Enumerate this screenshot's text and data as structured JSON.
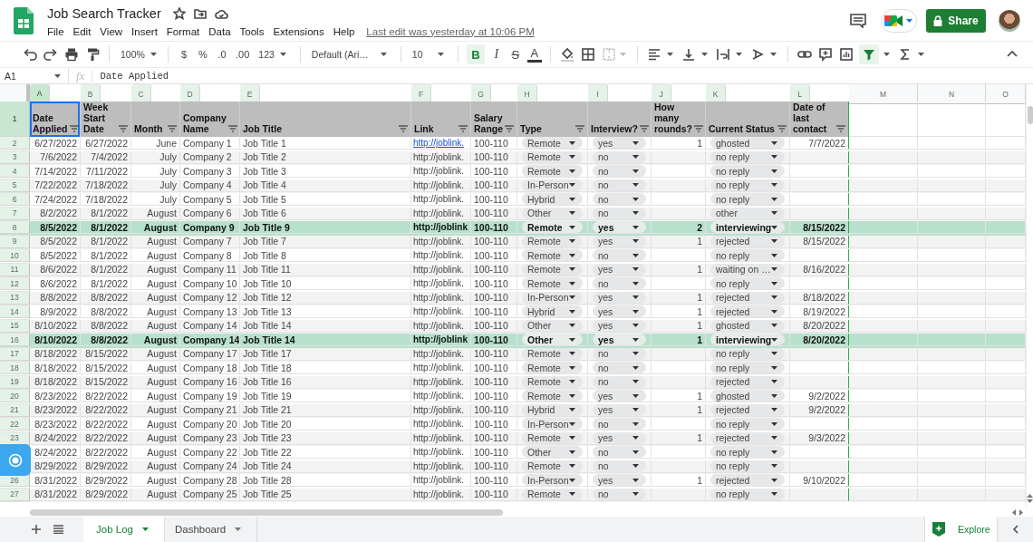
{
  "app": {
    "title": "Job Search Tracker",
    "menu": [
      "File",
      "Edit",
      "View",
      "Insert",
      "Format",
      "Data",
      "Tools",
      "Extensions",
      "Help"
    ],
    "last_edit": "Last edit was yesterday at 10:06 PM",
    "share": "Share"
  },
  "toolbar": {
    "zoom": "100%",
    "currency": "$",
    "percent": "%",
    "decimal_decrease": ".0",
    "decimal_increase": ".00",
    "number_format": "123",
    "font": "Default (Ari…",
    "font_size": "10",
    "bold": {
      "label": "B",
      "on": true
    },
    "italic": "I",
    "strikethrough": "S",
    "text_color": "A",
    "filter_on": true
  },
  "formula_bar": {
    "cell": "A1",
    "fx": "fx",
    "value": "Date Applied"
  },
  "columns": [
    {
      "letter": "A",
      "selected": true,
      "filtered": true
    },
    {
      "letter": "B",
      "selected": false,
      "filtered": true
    },
    {
      "letter": "C",
      "selected": false,
      "filtered": true
    },
    {
      "letter": "D",
      "selected": false,
      "filtered": true
    },
    {
      "letter": "E",
      "selected": false,
      "filtered": true
    },
    {
      "letter": "F",
      "selected": false,
      "filtered": true
    },
    {
      "letter": "G",
      "selected": false,
      "filtered": true
    },
    {
      "letter": "H",
      "selected": false,
      "filtered": true
    },
    {
      "letter": "I",
      "selected": false,
      "filtered": true
    },
    {
      "letter": "J",
      "selected": false,
      "filtered": true
    },
    {
      "letter": "K",
      "selected": false,
      "filtered": true
    },
    {
      "letter": "L",
      "selected": false,
      "filtered": true
    },
    {
      "letter": "M",
      "selected": false,
      "filtered": false
    },
    {
      "letter": "N",
      "selected": false,
      "filtered": false
    },
    {
      "letter": "O",
      "selected": false,
      "filtered": false
    }
  ],
  "header_row": {
    "num": "1",
    "cells": [
      {
        "text": "Date Applied",
        "kind": "date"
      },
      {
        "text": "Week Start Date",
        "kind": "date"
      },
      {
        "text": "Month",
        "kind": "month"
      },
      {
        "text": "Company Name",
        "kind": "text"
      },
      {
        "text": "Job Title",
        "kind": "text"
      },
      {
        "text": "Link",
        "kind": "link"
      },
      {
        "text": "Salary Range",
        "kind": "text"
      },
      {
        "text": "Type",
        "kind": "choice"
      },
      {
        "text": "Interview?",
        "kind": "choice"
      },
      {
        "text": "How many rounds?",
        "kind": "count"
      },
      {
        "text": "Current Status",
        "kind": "choice"
      },
      {
        "text": "Date of last contact",
        "kind": "date"
      }
    ]
  },
  "rows": [
    {
      "num": "2",
      "highlighted": false,
      "link_underlined": true,
      "cells": [
        "6/27/2022",
        "6/27/2022",
        "June",
        "Company 1",
        "Job Title 1",
        "http://joblink.",
        "100-110",
        "Remote",
        "yes",
        "1",
        "ghosted",
        "7/7/2022"
      ]
    },
    {
      "num": "3",
      "highlighted": false,
      "link_underlined": false,
      "cells": [
        "7/6/2022",
        "7/4/2022",
        "July",
        "Company 2",
        "Job Title 2",
        "http://joblink.",
        "100-110",
        "Remote",
        "no",
        null,
        "no reply",
        null
      ]
    },
    {
      "num": "4",
      "highlighted": false,
      "link_underlined": false,
      "cells": [
        "7/14/2022",
        "7/11/2022",
        "July",
        "Company 3",
        "Job Title 3",
        "http://joblink.",
        "100-110",
        "Remote",
        "no",
        null,
        "no reply",
        null
      ]
    },
    {
      "num": "5",
      "highlighted": false,
      "link_underlined": false,
      "cells": [
        "7/22/2022",
        "7/18/2022",
        "July",
        "Company 4",
        "Job Title 4",
        "http://joblink.",
        "100-110",
        "In-Person",
        "no",
        null,
        "no reply",
        null
      ]
    },
    {
      "num": "6",
      "highlighted": false,
      "link_underlined": false,
      "cells": [
        "7/24/2022",
        "7/18/2022",
        "July",
        "Company 5",
        "Job Title 5",
        "http://joblink.",
        "100-110",
        "Hybrid",
        "no",
        null,
        "no reply",
        null
      ]
    },
    {
      "num": "7",
      "highlighted": false,
      "link_underlined": false,
      "cells": [
        "8/2/2022",
        "8/1/2022",
        "August",
        "Company 6",
        "Job Title 6",
        "http://joblink.",
        "100-110",
        "Other",
        "no",
        null,
        "other",
        null
      ]
    },
    {
      "num": "8",
      "highlighted": true,
      "link_underlined": false,
      "cells": [
        "8/5/2022",
        "8/1/2022",
        "August",
        "Company 9",
        "Job Title 9",
        "http://joblink",
        "100-110",
        "Remote",
        "yes",
        "2",
        "interviewing",
        "8/15/2022"
      ]
    },
    {
      "num": "9",
      "highlighted": false,
      "link_underlined": false,
      "cells": [
        "8/5/2022",
        "8/1/2022",
        "August",
        "Company 7",
        "Job Title 7",
        "http://joblink.",
        "100-110",
        "Remote",
        "yes",
        "1",
        "rejected",
        "8/15/2022"
      ]
    },
    {
      "num": "10",
      "highlighted": false,
      "link_underlined": false,
      "cells": [
        "8/5/2022",
        "8/1/2022",
        "August",
        "Company 8",
        "Job Title 8",
        "http://joblink.",
        "100-110",
        "Remote",
        "no",
        null,
        "no reply",
        null
      ]
    },
    {
      "num": "11",
      "highlighted": false,
      "link_underlined": false,
      "cells": [
        "8/6/2022",
        "8/1/2022",
        "August",
        "Company 11",
        "Job Title 11",
        "http://joblink.",
        "100-110",
        "Remote",
        "yes",
        "1",
        "waiting on …",
        "8/16/2022"
      ]
    },
    {
      "num": "12",
      "highlighted": false,
      "link_underlined": false,
      "cells": [
        "8/6/2022",
        "8/1/2022",
        "August",
        "Company 10",
        "Job Title 10",
        "http://joblink.",
        "100-110",
        "Remote",
        "no",
        null,
        "no reply",
        null
      ]
    },
    {
      "num": "13",
      "highlighted": false,
      "link_underlined": false,
      "cells": [
        "8/8/2022",
        "8/8/2022",
        "August",
        "Company 12",
        "Job Title 12",
        "http://joblink.",
        "100-110",
        "In-Person",
        "yes",
        "1",
        "rejected",
        "8/18/2022"
      ]
    },
    {
      "num": "14",
      "highlighted": false,
      "link_underlined": false,
      "cells": [
        "8/9/2022",
        "8/8/2022",
        "August",
        "Company 13",
        "Job Title 13",
        "http://joblink.",
        "100-110",
        "Hybrid",
        "yes",
        "1",
        "rejected",
        "8/19/2022"
      ]
    },
    {
      "num": "15",
      "highlighted": false,
      "link_underlined": false,
      "cells": [
        "8/10/2022",
        "8/8/2022",
        "August",
        "Company 14",
        "Job Title 14",
        "http://joblink.",
        "100-110",
        "Other",
        "yes",
        "1",
        "ghosted",
        "8/20/2022"
      ]
    },
    {
      "num": "16",
      "highlighted": true,
      "link_underlined": false,
      "cells": [
        "8/10/2022",
        "8/8/2022",
        "August",
        "Company 14",
        "Job Title 14",
        "http://joblink",
        "100-110",
        "Other",
        "yes",
        "1",
        "interviewing",
        "8/20/2022"
      ]
    },
    {
      "num": "17",
      "highlighted": false,
      "link_underlined": false,
      "cells": [
        "8/18/2022",
        "8/15/2022",
        "August",
        "Company 17",
        "Job Title 17",
        "http://joblink.",
        "100-110",
        "Remote",
        "no",
        null,
        "no reply",
        null
      ]
    },
    {
      "num": "18",
      "highlighted": false,
      "link_underlined": false,
      "cells": [
        "8/18/2022",
        "8/15/2022",
        "August",
        "Company 18",
        "Job Title 18",
        "http://joblink.",
        "100-110",
        "Remote",
        "no",
        null,
        "no reply",
        null
      ]
    },
    {
      "num": "19",
      "highlighted": false,
      "link_underlined": false,
      "cells": [
        "8/18/2022",
        "8/15/2022",
        "August",
        "Company 16",
        "Job Title 16",
        "http://joblink.",
        "100-110",
        "Remote",
        "no",
        null,
        "rejected",
        null
      ]
    },
    {
      "num": "20",
      "highlighted": false,
      "link_underlined": false,
      "cells": [
        "8/23/2022",
        "8/22/2022",
        "August",
        "Company 19",
        "Job Title 19",
        "http://joblink.",
        "100-110",
        "Remote",
        "yes",
        "1",
        "ghosted",
        "9/2/2022"
      ]
    },
    {
      "num": "21",
      "highlighted": false,
      "link_underlined": false,
      "cells": [
        "8/23/2022",
        "8/22/2022",
        "August",
        "Company 21",
        "Job Title 21",
        "http://joblink.",
        "100-110",
        "Hybrid",
        "yes",
        "1",
        "rejected",
        "9/2/2022"
      ]
    },
    {
      "num": "22",
      "highlighted": false,
      "link_underlined": false,
      "cells": [
        "8/23/2022",
        "8/22/2022",
        "August",
        "Company 20",
        "Job Title 20",
        "http://joblink.",
        "100-110",
        "In-Person",
        "no",
        null,
        "no reply",
        null
      ]
    },
    {
      "num": "23",
      "highlighted": false,
      "link_underlined": false,
      "cells": [
        "8/24/2022",
        "8/22/2022",
        "August",
        "Company 23",
        "Job Title 23",
        "http://joblink.",
        "100-110",
        "Remote",
        "yes",
        "1",
        "rejected",
        "9/3/2022"
      ]
    },
    {
      "highlighted": false,
      "link_underlined": false,
      "cells": [
        "8/24/2022",
        "8/22/2022",
        "August",
        "Company 22",
        "Job Title 22",
        "http://joblink.",
        "100-110",
        "Other",
        "no",
        null,
        "no reply",
        null
      ]
    },
    {
      "highlighted": false,
      "link_underlined": false,
      "cells": [
        "8/29/2022",
        "8/29/2022",
        "August",
        "Company 24",
        "Job Title 24",
        "http://joblink.",
        "100-110",
        "Remote",
        "no",
        null,
        "no reply",
        null
      ]
    },
    {
      "num": "26",
      "highlighted": false,
      "link_underlined": false,
      "cells": [
        "8/31/2022",
        "8/29/2022",
        "August",
        "Company 28",
        "Job Title 28",
        "http://joblink.",
        "100-110",
        "In-Person",
        "yes",
        "1",
        "rejected",
        "9/10/2022"
      ]
    },
    {
      "num": "27",
      "highlighted": false,
      "link_underlined": false,
      "cells": [
        "8/31/2022",
        "8/29/2022",
        "August",
        "Company 25",
        "Job Title 25",
        "http://joblink.",
        "100-110",
        "Remote",
        "no",
        null,
        "no reply",
        null
      ]
    }
  ],
  "sheet_tabs": [
    {
      "label": "Job Log",
      "selected": true
    },
    {
      "label": "Dashboard",
      "selected": false
    }
  ],
  "explore": "Explore"
}
